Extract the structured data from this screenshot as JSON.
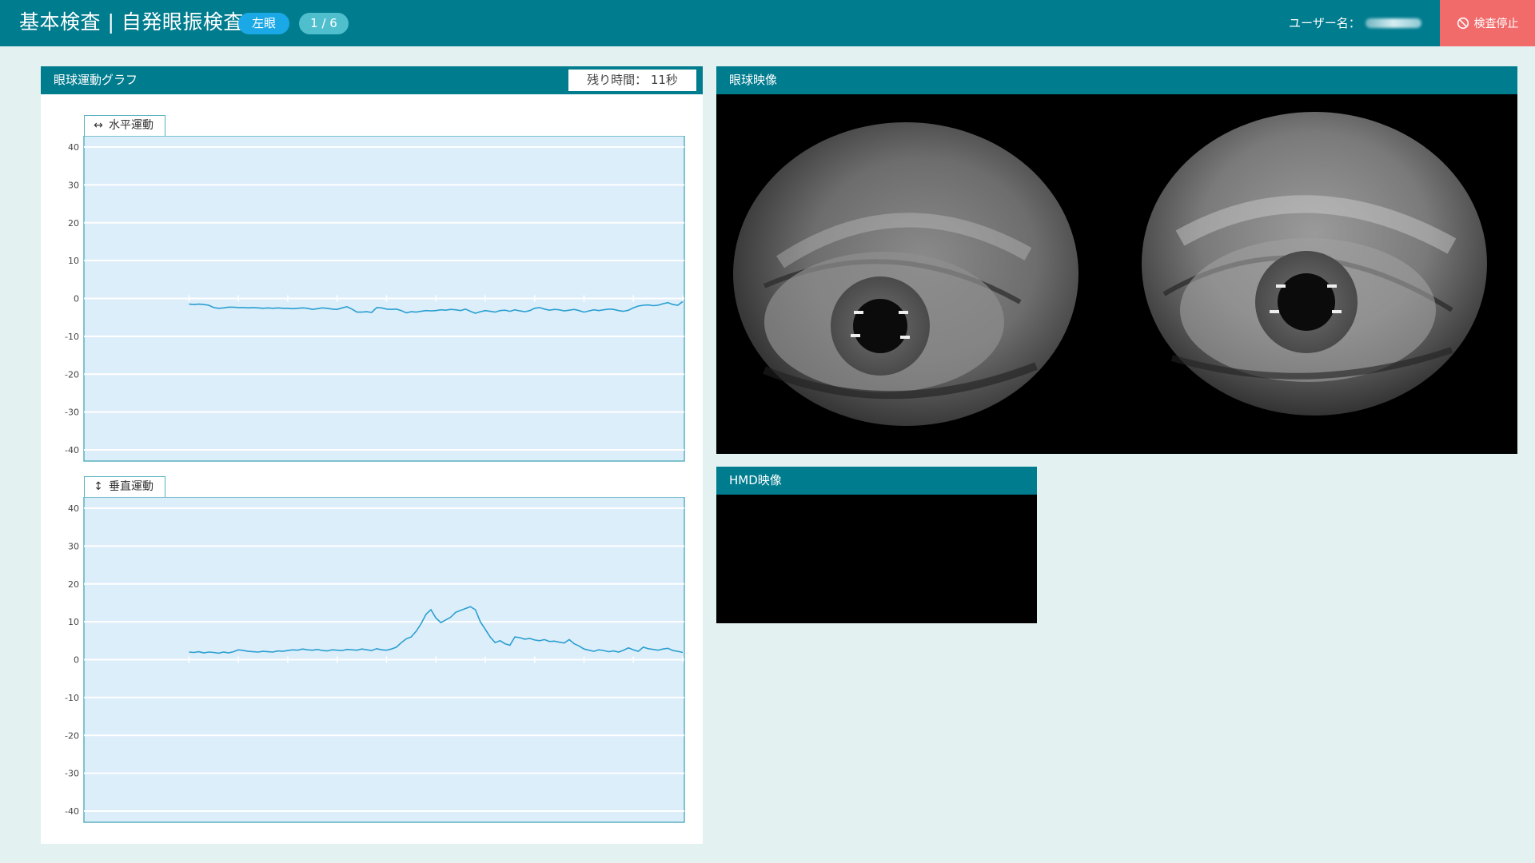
{
  "header": {
    "title": "基本検査 | 自発眼振検査",
    "eye_badge": "左眼",
    "step_badge": "1 / 6",
    "user_label": "ユーザー名：",
    "stop_label": "検査停止",
    "stop_icon": "prohibit-icon"
  },
  "graph_panel": {
    "title": "眼球運動グラフ",
    "remaining_time": "残り時間： 11秒"
  },
  "charts": {
    "horizontal": {
      "label": "水平運動",
      "icon": "horizontal-arrows-icon",
      "ylim": [
        -40,
        40
      ],
      "yticks": [
        "40",
        "30",
        "20",
        "10",
        "0",
        "-10",
        "-20",
        "-30",
        "-40"
      ]
    },
    "vertical": {
      "label": "垂直運動",
      "icon": "vertical-arrows-icon",
      "ylim": [
        -40,
        40
      ],
      "yticks": [
        "40",
        "30",
        "20",
        "10",
        "0",
        "-10",
        "-20",
        "-30",
        "-40"
      ]
    }
  },
  "chart_data": [
    {
      "type": "line",
      "ylim": [
        -40,
        40
      ],
      "grid": true,
      "x": [
        0,
        1,
        2,
        3,
        4,
        5,
        6,
        7,
        8,
        9,
        10,
        11,
        12,
        13,
        14,
        15,
        16,
        17,
        18,
        19,
        20,
        21,
        22,
        23,
        24,
        25,
        26,
        27,
        28,
        29,
        30,
        31,
        32,
        33,
        34,
        35,
        36,
        37,
        38,
        39,
        40,
        41,
        42,
        43,
        44,
        45,
        46,
        47,
        48,
        49,
        50,
        51,
        52,
        53,
        54,
        55,
        56,
        57,
        58,
        59,
        60,
        61,
        62,
        63,
        64,
        65,
        66,
        67,
        68,
        69,
        70,
        71,
        72,
        73,
        74,
        75,
        76,
        77,
        78,
        79,
        80,
        81,
        82,
        83,
        84,
        85,
        86,
        87,
        88,
        89,
        90,
        91,
        92,
        93,
        94,
        95,
        96,
        97,
        98,
        99,
        100
      ],
      "series": [
        {
          "values": [
            -1.5,
            -1.6,
            -1.5,
            -1.6,
            -1.8,
            -2.4,
            -2.6,
            -2.5,
            -2.3,
            -2.3,
            -2.4,
            -2.4,
            -2.5,
            -2.4,
            -2.5,
            -2.6,
            -2.5,
            -2.6,
            -2.5,
            -2.6,
            -2.6,
            -2.7,
            -2.6,
            -2.5,
            -2.6,
            -2.9,
            -2.7,
            -2.5,
            -2.6,
            -2.8,
            -2.9,
            -2.5,
            -2.2,
            -2.8,
            -3.6,
            -3.6,
            -3.5,
            -3.7,
            -2.4,
            -2.5,
            -2.8,
            -2.9,
            -2.8,
            -3.2,
            -3.8,
            -3.5,
            -3.6,
            -3.4,
            -3.2,
            -3.3,
            -3.2,
            -3.0,
            -3.1,
            -2.9,
            -3.0,
            -3.2,
            -2.8,
            -3.4,
            -3.9,
            -3.5,
            -3.2,
            -3.4,
            -3.6,
            -3.2,
            -3.1,
            -3.4,
            -3.0,
            -3.3,
            -3.5,
            -3.2,
            -2.6,
            -2.4,
            -2.8,
            -3.1,
            -2.9,
            -3.0,
            -3.3,
            -3.1,
            -2.9,
            -3.2,
            -3.6,
            -3.3,
            -3.0,
            -3.2,
            -3.0,
            -2.8,
            -2.9,
            -3.2,
            -3.4,
            -3.1,
            -2.5,
            -2.0,
            -1.8,
            -1.7,
            -1.9,
            -1.8,
            -1.4,
            -1.1,
            -1.6,
            -1.8,
            -0.8
          ]
        }
      ]
    },
    {
      "type": "line",
      "ylim": [
        -40,
        40
      ],
      "grid": true,
      "x": [
        0,
        1,
        2,
        3,
        4,
        5,
        6,
        7,
        8,
        9,
        10,
        11,
        12,
        13,
        14,
        15,
        16,
        17,
        18,
        19,
        20,
        21,
        22,
        23,
        24,
        25,
        26,
        27,
        28,
        29,
        30,
        31,
        32,
        33,
        34,
        35,
        36,
        37,
        38,
        39,
        40,
        41,
        42,
        43,
        44,
        45,
        46,
        47,
        48,
        49,
        50,
        51,
        52,
        53,
        54,
        55,
        56,
        57,
        58,
        59,
        60,
        61,
        62,
        63,
        64,
        65,
        66,
        67,
        68,
        69,
        70,
        71,
        72,
        73,
        74,
        75,
        76,
        77,
        78,
        79,
        80,
        81,
        82,
        83,
        84,
        85,
        86,
        87,
        88,
        89,
        90,
        91,
        92,
        93,
        94,
        95,
        96,
        97,
        98,
        99,
        100
      ],
      "series": [
        {
          "values": [
            2.0,
            1.9,
            2.1,
            1.8,
            2.0,
            1.9,
            1.7,
            2.0,
            1.8,
            2.1,
            2.6,
            2.4,
            2.2,
            2.1,
            2.0,
            2.2,
            2.1,
            2.0,
            2.3,
            2.2,
            2.4,
            2.6,
            2.5,
            2.8,
            2.6,
            2.5,
            2.7,
            2.4,
            2.3,
            2.6,
            2.5,
            2.4,
            2.7,
            2.6,
            2.5,
            2.8,
            2.6,
            2.4,
            2.9,
            2.6,
            2.5,
            2.8,
            3.3,
            4.5,
            5.5,
            6.0,
            7.5,
            9.5,
            12.0,
            13.2,
            11.0,
            9.8,
            10.5,
            11.2,
            12.5,
            13.0,
            13.5,
            14.0,
            13.2,
            10.0,
            8.0,
            6.0,
            4.5,
            5.0,
            4.2,
            3.8,
            6.0,
            5.8,
            5.4,
            5.6,
            5.2,
            5.0,
            5.3,
            4.8,
            4.9,
            4.6,
            4.4,
            5.3,
            4.2,
            3.6,
            2.8,
            2.5,
            2.2,
            2.6,
            2.4,
            2.1,
            2.3,
            2.0,
            2.5,
            3.1,
            2.6,
            2.2,
            3.3,
            2.9,
            2.7,
            2.5,
            2.8,
            3.0,
            2.4,
            2.2,
            1.9
          ]
        }
      ]
    }
  ],
  "video_panel": {
    "title": "眼球映像"
  },
  "hmd_panel": {
    "title": "HMD映像"
  },
  "colors": {
    "header": "#007c8f",
    "accent_blue": "#1aa9e6",
    "stop_red": "#f26b6b",
    "graph_bg": "#ddeefb",
    "trace": "#2a9fd0"
  }
}
